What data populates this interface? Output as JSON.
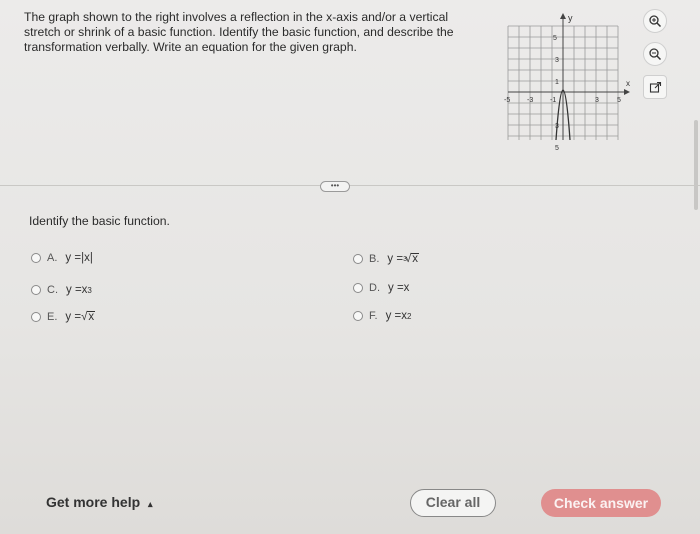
{
  "question": {
    "text": "The graph shown to the right involves a reflection in the x-axis and/or a vertical stretch or shrink of a basic function. Identify the basic function, and describe the transformation verbally. Write an equation for the given graph."
  },
  "graph": {
    "axis_y": "y",
    "axis_x": "x",
    "labels": {
      "y5": "5",
      "y3": "3",
      "y1": "1",
      "yn3": "3",
      "yn5": "5",
      "xn5": "-5",
      "xn3": "-3",
      "xn1": "-1",
      "x3": "3",
      "x5": "5"
    }
  },
  "more_label": "•••",
  "prompt": "Identify the basic function.",
  "options": [
    {
      "letter": "A.",
      "lhs": "y = ",
      "expr": "|x|"
    },
    {
      "letter": "B.",
      "lhs": "y = ",
      "index": "3",
      "expr": "x"
    },
    {
      "letter": "C.",
      "lhs": "y = ",
      "base": "x",
      "power": "3"
    },
    {
      "letter": "D.",
      "lhs": "y = ",
      "expr": "x"
    },
    {
      "letter": "E.",
      "lhs": "y = ",
      "expr": "x"
    },
    {
      "letter": "F.",
      "lhs": "y = ",
      "base": "x",
      "power": "2"
    }
  ],
  "footer": {
    "help": "Get more help",
    "help_arrow": "▴",
    "clear": "Clear all",
    "check": "Check answer"
  },
  "colors": {
    "check_button": "#e08f8f",
    "text": "#2b2b2b"
  }
}
